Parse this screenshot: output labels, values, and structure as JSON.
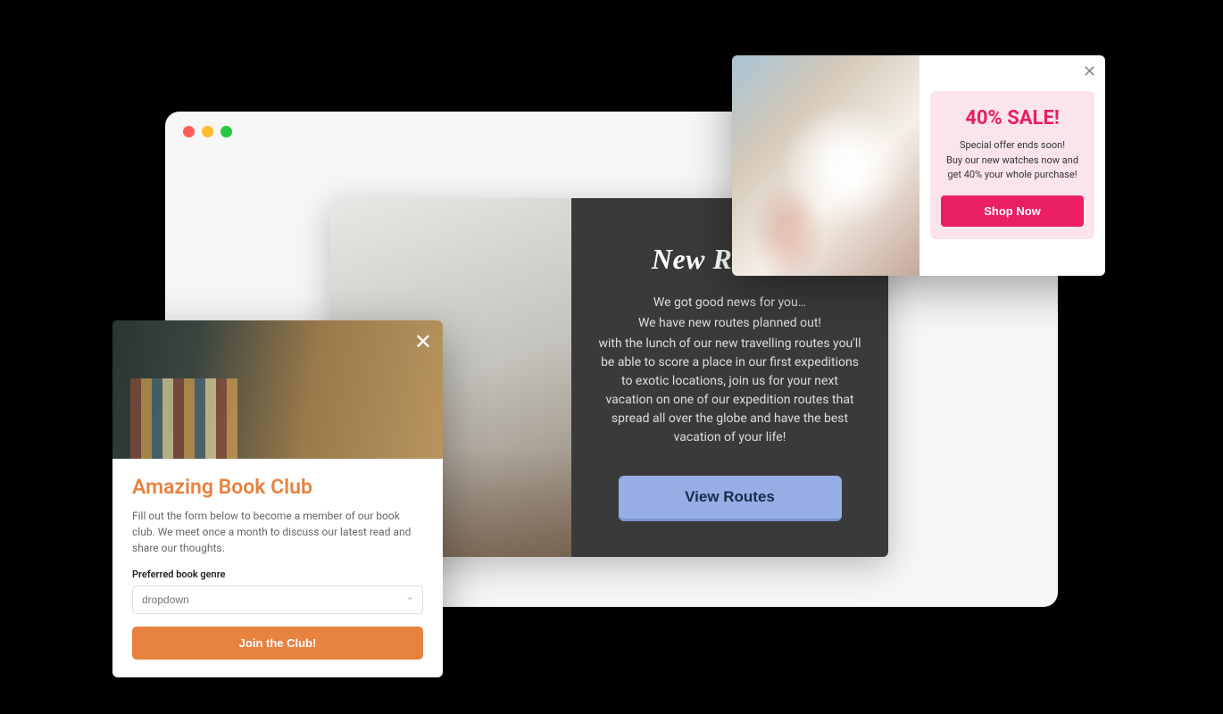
{
  "routes": {
    "title": "New Routes!",
    "line1": "We got good news for you…",
    "line2": "We have new routes planned out!",
    "line3": "with the lunch of our new travelling routes you'll be able to score a place in our first expeditions to exotic locations, join us for your next vacation on one of our expedition routes that spread all over the globe and have the best vacation of your life!",
    "button": "View Routes"
  },
  "sale": {
    "title": "40% SALE!",
    "line1": "Special offer ends soon!",
    "line2": "Buy our new watches now and get 40% your whole purchase!",
    "button": "Shop Now"
  },
  "book": {
    "title": "Amazing Book Club",
    "text": "Fill out the form below to become a member of our book club. We meet once a month to discuss our latest read and share our thoughts.",
    "label": "Preferred book genre",
    "placeholder": "dropdown",
    "button": "Join the Club!"
  }
}
